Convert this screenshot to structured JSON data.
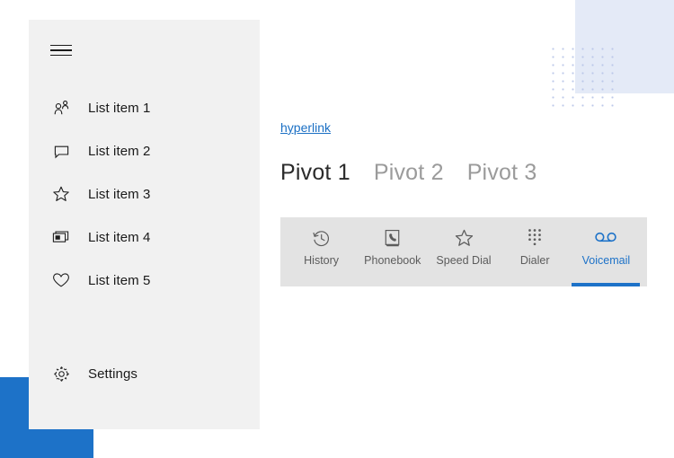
{
  "theme": {
    "accent": "#1d72c8",
    "sidebar_bg": "#f1f1f1",
    "toolbar_bg": "#e3e3e3",
    "link_color": "#1a6fc4",
    "deco_blue_rect": "#e4eaf7",
    "deco_dot_color": "#b9c6e8",
    "text_primary": "#1a1a1a",
    "text_muted": "#9b9b9b"
  },
  "sidebar": {
    "menu_button_name": "hamburger-menu",
    "items": [
      {
        "label": "List item 1",
        "icon": "contact-person-icon"
      },
      {
        "label": "List item 2",
        "icon": "chat-bubble-icon"
      },
      {
        "label": "List item 3",
        "icon": "star-outline-icon"
      },
      {
        "label": "List item 4",
        "icon": "window-stack-icon"
      },
      {
        "label": "List item 5",
        "icon": "heart-outline-icon"
      }
    ],
    "settings": {
      "label": "Settings",
      "icon": "gear-icon"
    }
  },
  "content": {
    "hyperlink_text": "hyperlink",
    "pivots": [
      {
        "label": "Pivot 1",
        "selected": true
      },
      {
        "label": "Pivot 2",
        "selected": false
      },
      {
        "label": "Pivot 3",
        "selected": false
      }
    ]
  },
  "toolbar": {
    "items": [
      {
        "label": "History",
        "icon": "history-clock-icon",
        "selected": false
      },
      {
        "label": "Phonebook",
        "icon": "phonebook-icon",
        "selected": false
      },
      {
        "label": "Speed Dial",
        "icon": "star-outline-icon",
        "selected": false
      },
      {
        "label": "Dialer",
        "icon": "keypad-dots-icon",
        "selected": false
      },
      {
        "label": "Voicemail",
        "icon": "voicemail-tape-icon",
        "selected": true
      }
    ]
  }
}
